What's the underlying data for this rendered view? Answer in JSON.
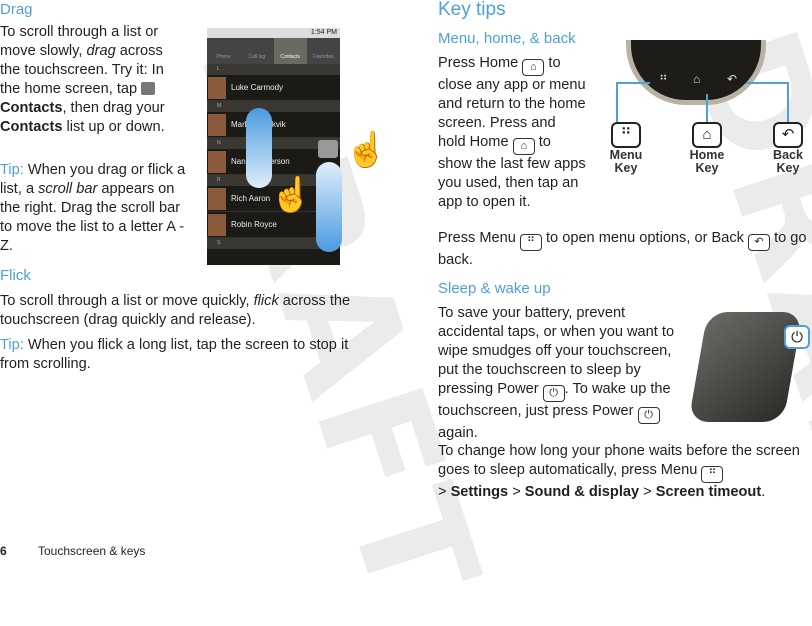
{
  "watermark": "DRAFT",
  "left": {
    "drag_heading": "Drag",
    "drag_p1": [
      "To scroll through a list or move slowly, ",
      "drag",
      " across the touchscreen. Try it: In the home screen, tap ",
      "Contacts",
      ", then drag your ",
      "Contacts",
      " list up or down."
    ],
    "drag_tip": [
      "Tip:",
      " When you drag or flick a list, a ",
      "scroll bar",
      " appears on the right. Drag the scroll bar to move the list to a letter A - Z."
    ],
    "flick_heading": "Flick",
    "flick_p1": [
      "To scroll through a list or move quickly, ",
      "flick",
      " across the touchscreen (drag quickly and release)."
    ],
    "flick_tip": [
      "Tip:",
      " When you flick a long list, tap the screen to stop it from scrolling."
    ]
  },
  "phone": {
    "time": "1:54 PM",
    "tabs": [
      "Phone",
      "Call log",
      "Contacts",
      "Favorites"
    ],
    "active_tab": "Contacts",
    "sections": [
      "L",
      "M",
      "N",
      "R",
      "S"
    ],
    "contacts": [
      "Luke Carmody",
      "Marlene Bukvik",
      "Nancy Anderson",
      "Rich Aaron",
      "Robin Royce"
    ]
  },
  "right": {
    "title": "Key tips",
    "mhb_heading": "Menu, home, & back",
    "mhb_p1": [
      "Press Home ",
      "to close any app or menu and return to the home screen. Press and hold Home ",
      "to show the last few apps you used, then tap an app to open it."
    ],
    "mhb_p2": [
      "Press Menu ",
      "to open menu options, or Back ",
      "to go back."
    ],
    "keys": {
      "menu": "Menu Key",
      "home": "Home Key",
      "back": "Back Key"
    },
    "sleep_heading": "Sleep & wake up",
    "sleep_p1": [
      "To save your battery, prevent accidental taps, or when you want to wipe smudges off your touchscreen, put the touchscreen to sleep by pressing Power ",
      ". To wake up the touchscreen, just press Power ",
      "again."
    ],
    "sleep_p2": [
      "To change how long your phone waits before the screen goes to sleep automatically, press Menu ",
      "> ",
      "Settings",
      " > ",
      "Sound & display",
      " > ",
      "Screen timeout",
      "."
    ]
  },
  "footer": {
    "page": "6",
    "section": "Touchscreen & keys"
  }
}
